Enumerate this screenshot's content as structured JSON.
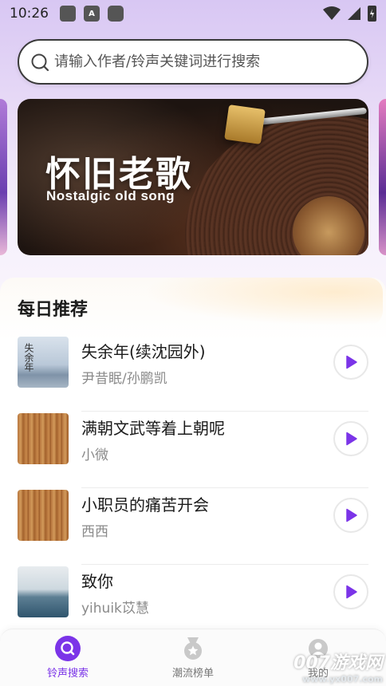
{
  "status_bar": {
    "time": "10:26",
    "icons": [
      "app-icon",
      "a-badge-icon",
      "app-icon-2"
    ],
    "right_icons": [
      "wifi-icon",
      "signal-icon",
      "battery-icon"
    ]
  },
  "search": {
    "placeholder": "请输入作者/铃声关键词进行搜索"
  },
  "banner": {
    "title": "怀旧老歌",
    "subtitle": "Nostalgic old song"
  },
  "recommend": {
    "title": "每日推荐",
    "songs": [
      {
        "name": "失余年(续沈园外)",
        "artist": "尹昔眠/孙鹏凯",
        "cover_text": "失余年"
      },
      {
        "name": "满朝文武等着上朝呢",
        "artist": "小微"
      },
      {
        "name": "小职员的痛苦开会",
        "artist": "西西"
      },
      {
        "name": "致你",
        "artist": "yihuik苡慧"
      }
    ]
  },
  "nav": {
    "items": [
      {
        "label": "铃声搜索",
        "active": true
      },
      {
        "label": "潮流榜单",
        "active": false
      },
      {
        "label": "我的",
        "active": false
      }
    ]
  },
  "watermark": {
    "main": "007游戏网",
    "url": "www.yx007.com"
  },
  "colors": {
    "accent": "#7b34e8",
    "inactive": "#777777"
  }
}
